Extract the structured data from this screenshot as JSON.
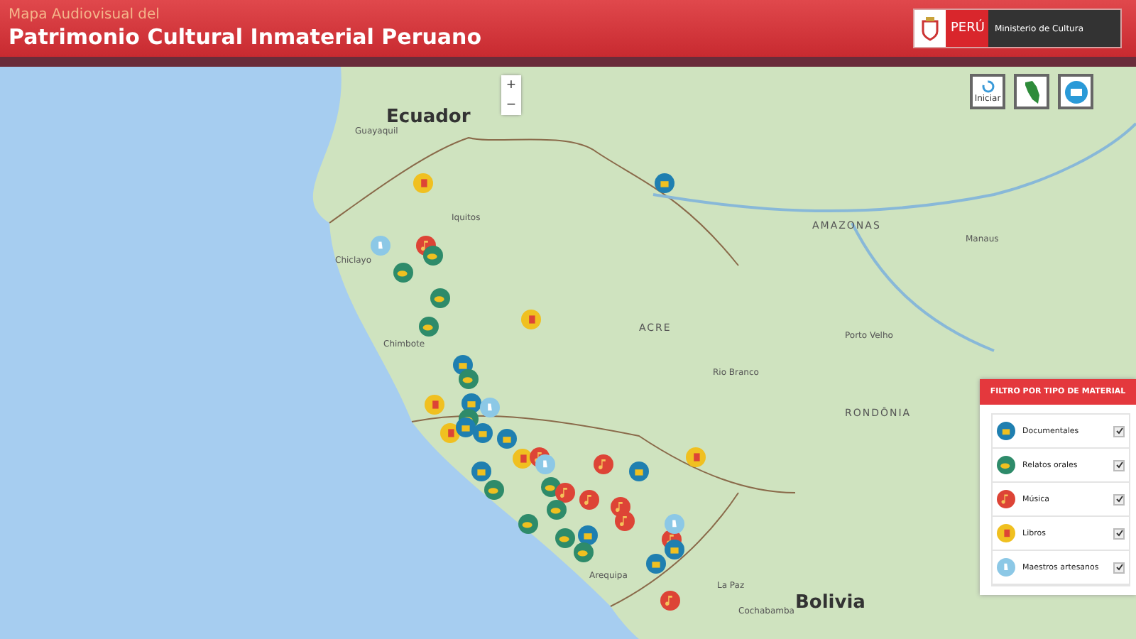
{
  "header": {
    "subtitle": "Mapa Audiovisual del",
    "title": "Patrimonio Cultural Inmaterial Peruano",
    "logo": {
      "country": "PERÚ",
      "ministry": "Ministerio de Cultura"
    }
  },
  "map_controls": {
    "zoom_in": "+",
    "zoom_out": "−"
  },
  "top_buttons": [
    {
      "kind": "reset",
      "label": "Iniciar"
    },
    {
      "kind": "country"
    },
    {
      "kind": "mail"
    }
  ],
  "map_labels": [
    {
      "text": "Ecuador",
      "kind": "country"
    },
    {
      "text": "Guayaquil",
      "kind": "city"
    },
    {
      "text": "Iquitos",
      "kind": "city"
    },
    {
      "text": "AMAZONAS",
      "kind": "region"
    },
    {
      "text": "Manaus",
      "kind": "city"
    },
    {
      "text": "Chiclayo",
      "kind": "city"
    },
    {
      "text": "ACRE",
      "kind": "region"
    },
    {
      "text": "Porto Velho",
      "kind": "city"
    },
    {
      "text": "Chimbote",
      "kind": "city"
    },
    {
      "text": "Rio Branco",
      "kind": "city"
    },
    {
      "text": "RONDÔNIA",
      "kind": "region"
    },
    {
      "text": "Arequipa",
      "kind": "city"
    },
    {
      "text": "La Paz",
      "kind": "city"
    },
    {
      "text": "Bolivia",
      "kind": "country"
    },
    {
      "text": "Cochabamba",
      "kind": "city"
    }
  ],
  "filter": {
    "title": "FILTRO POR TIPO DE MATERIAL",
    "items": [
      {
        "kind": "documentales",
        "label": "Documentales",
        "checked": true
      },
      {
        "kind": "relatos",
        "label": "Relatos orales",
        "checked": true
      },
      {
        "kind": "musica",
        "label": "Música",
        "checked": true
      },
      {
        "kind": "libros",
        "label": "Libros",
        "checked": true
      },
      {
        "kind": "maestros",
        "label": "Maestros artesanos",
        "checked": true
      }
    ]
  }
}
